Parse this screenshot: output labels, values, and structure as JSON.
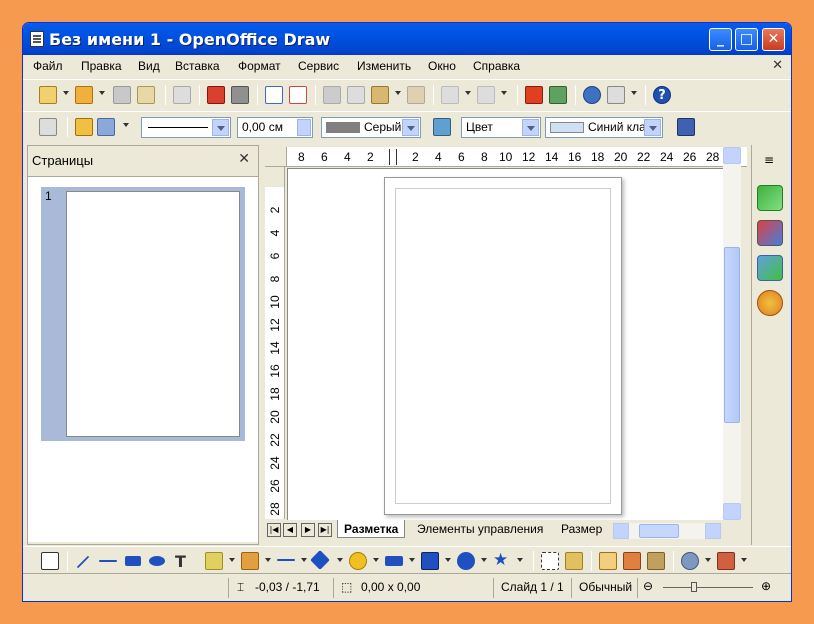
{
  "window": {
    "title": "Без имени 1 - OpenOffice Draw"
  },
  "menu": {
    "items": [
      "Файл",
      "Правка",
      "Вид",
      "Вставка",
      "Формат",
      "Сервис",
      "Изменить",
      "Окно",
      "Справка"
    ]
  },
  "toolbar2": {
    "line_width": "0,00 см",
    "line_color": "Серый",
    "area_style": "Цвет",
    "area_color": "Синий кла"
  },
  "pages_pane": {
    "title": "Страницы",
    "page_number": "1"
  },
  "hruler": {
    "labels": [
      "8",
      "6",
      "4",
      "2",
      "2",
      "4",
      "6",
      "8",
      "10",
      "12",
      "14",
      "16",
      "18",
      "20",
      "22",
      "24",
      "26",
      "28"
    ]
  },
  "vruler": {
    "labels": [
      "2",
      "4",
      "6",
      "8",
      "10",
      "12",
      "14",
      "16",
      "18",
      "20",
      "22",
      "24",
      "26",
      "28"
    ]
  },
  "tabs": [
    "Разметка",
    "Элементы управления",
    "Размер"
  ],
  "status": {
    "position": "-0,03 / -1,71",
    "size": "0,00 x 0,00",
    "slide": "Слайд 1 / 1",
    "layout": "Обычный"
  },
  "colors": {
    "desktop": "#f59a4e",
    "titlebar": "#0055e5",
    "chrome": "#ece9d8",
    "line_color_swatch": "#808080",
    "area_color_swatch": "#cfe0f5"
  }
}
